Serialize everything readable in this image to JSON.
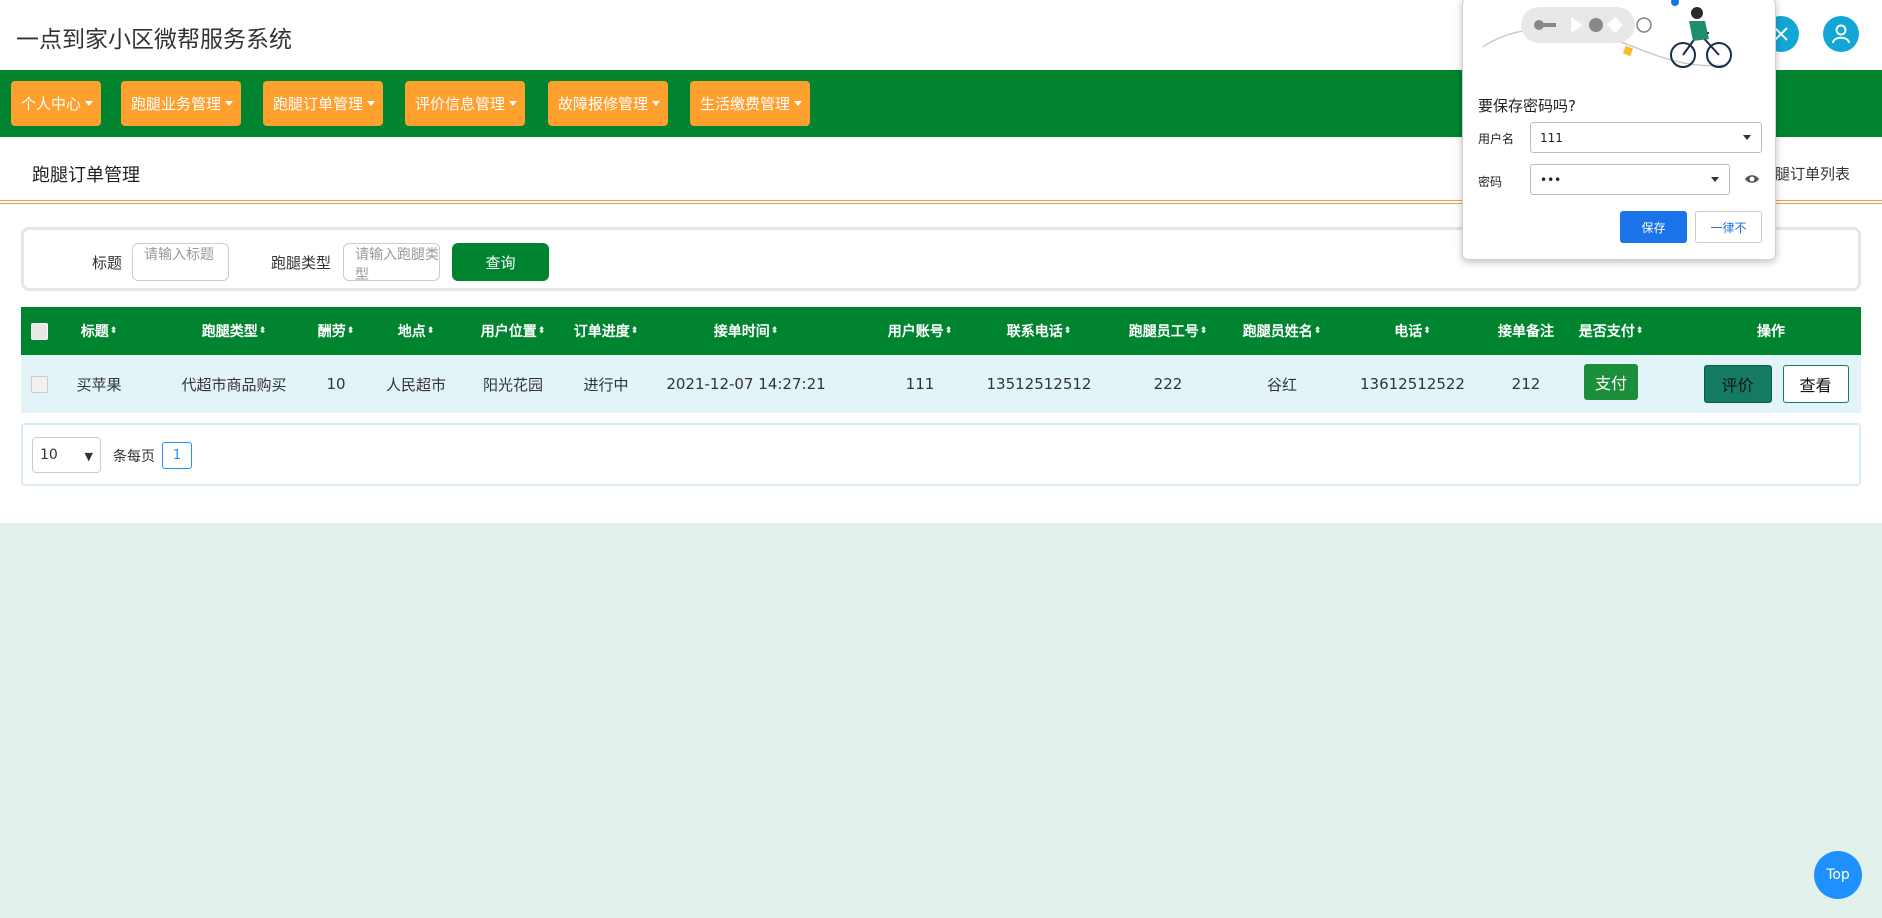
{
  "header": {
    "app_title": "一点到家小区微帮服务系统"
  },
  "nav": [
    {
      "label": "个人中心"
    },
    {
      "label": "跑腿业务管理"
    },
    {
      "label": "跑腿订单管理"
    },
    {
      "label": "评价信息管理"
    },
    {
      "label": "故障报修管理"
    },
    {
      "label": "生活缴费管理"
    }
  ],
  "breadcrumb": {
    "title": "跑腿订单管理",
    "right": "腿订单列表"
  },
  "search": {
    "title_label": "标题",
    "title_placeholder": "请输入标题",
    "type_label": "跑腿类型",
    "type_placeholder": "请输入跑腿类型",
    "query_button": "查询"
  },
  "table": {
    "headers": [
      "标题",
      "跑腿类型",
      "酬劳",
      "地点",
      "用户位置",
      "订单进度",
      "接单时间",
      "用户账号",
      "联系电话",
      "跑腿员工号",
      "跑腿员姓名",
      "电话",
      "接单备注",
      "是否支付",
      "操作"
    ],
    "sort_glyph": "⬍",
    "rows": [
      {
        "title": "买苹果",
        "type": "代超市商品购买",
        "reward": "10",
        "place": "人民超市",
        "user_location": "阳光花园",
        "progress": "进行中",
        "time": "2021-12-07 14:27:21",
        "account": "111",
        "contact_phone": "13512512512",
        "runner_id": "222",
        "runner_name": "谷红",
        "phone": "13612512522",
        "note": "212",
        "pay_button": "支付",
        "rate_button": "评价",
        "view_button": "查看"
      }
    ]
  },
  "pagination": {
    "page_size": "10",
    "per_page_text": "条每页",
    "current_page": "1"
  },
  "top_button": "Top",
  "password_popup": {
    "title": "要保存密码吗?",
    "username_label": "用户名",
    "username_value": "111",
    "password_label": "密码",
    "password_value": "•••",
    "save_button": "保存",
    "never_button": "一律不"
  },
  "colors": {
    "nav_green": "#008430",
    "nav_orange": "#ff9f2e",
    "accent_blue": "#1e90ff"
  }
}
